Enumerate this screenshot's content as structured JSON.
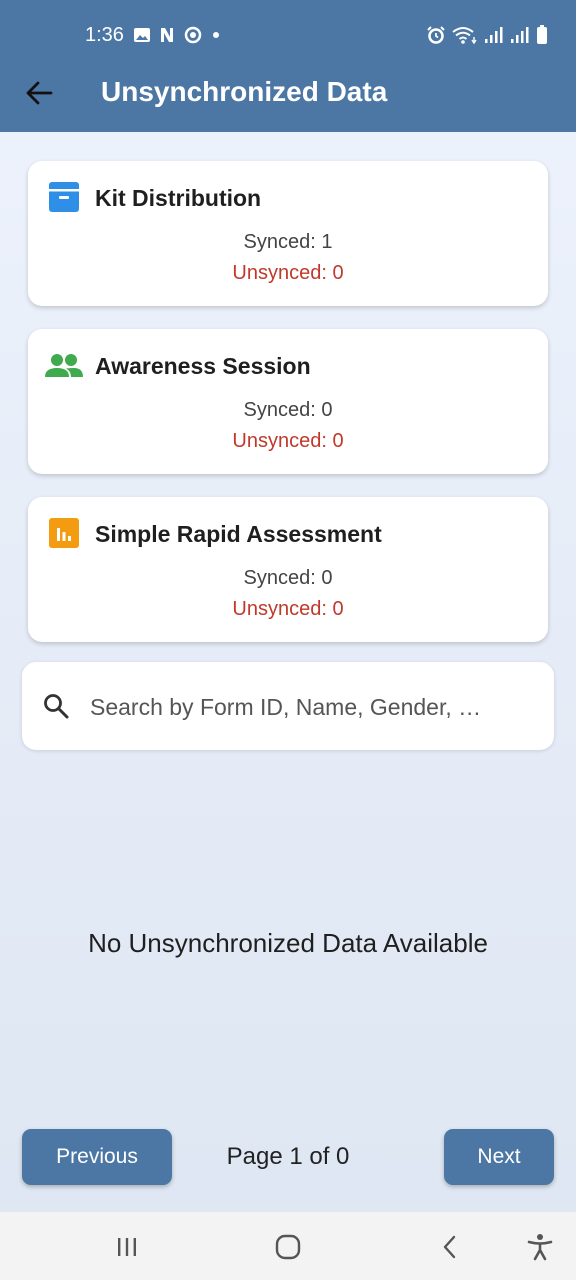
{
  "status_bar": {
    "time": "1:36"
  },
  "header": {
    "title": "Unsynchronized Data",
    "back_icon": "arrow-left-icon"
  },
  "cards": [
    {
      "title": "Kit Distribution",
      "icon": "archive-box-icon",
      "icon_color": "#2f8ee6",
      "synced": "Synced: 1",
      "unsynced": "Unsynced: 0"
    },
    {
      "title": "Awareness Session",
      "icon": "people-icon",
      "icon_color": "#3faa4e",
      "synced": "Synced: 0",
      "unsynced": "Unsynced: 0"
    },
    {
      "title": "Simple Rapid Assessment",
      "icon": "bar-chart-icon",
      "icon_color": "#f39c12",
      "synced": "Synced: 0",
      "unsynced": "Unsynced: 0"
    }
  ],
  "search": {
    "placeholder": "Search by Form ID, Name, Gender, …"
  },
  "empty_message": "No Unsynchronized Data Available",
  "pagination": {
    "previous_label": "Previous",
    "page_label": "Page 1 of 0",
    "next_label": "Next"
  },
  "colors": {
    "primary": "#4c77a5",
    "unsynced_text": "#c0392b"
  }
}
